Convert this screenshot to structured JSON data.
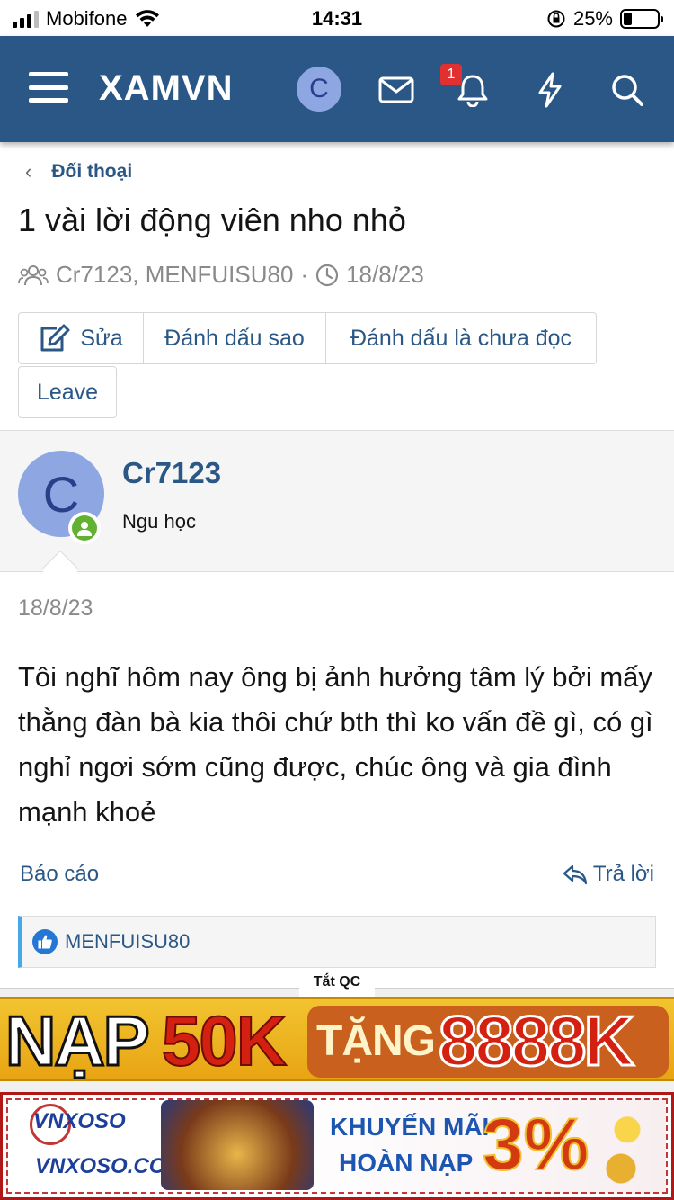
{
  "status_bar": {
    "carrier": "Mobifone",
    "time": "14:31",
    "battery": "25%"
  },
  "nav": {
    "logo": "XAMVN",
    "avatar_letter": "C",
    "notification_count": "1"
  },
  "breadcrumb": {
    "label": "Đối thoại"
  },
  "thread": {
    "title": "1 vài lời động viên nho nhỏ",
    "participants": "Cr7123, MENFUISU80",
    "separator": "·",
    "date": "18/8/23"
  },
  "actions": {
    "edit": "Sửa",
    "star": "Đánh dấu sao",
    "mark_unread": "Đánh dấu là chưa đọc",
    "leave": "Leave"
  },
  "message": {
    "avatar_letter": "C",
    "username": "Cr7123",
    "user_title": "Ngu học",
    "date": "18/8/23",
    "body": "Tôi nghĩ hôm nay ông bị ảnh hưởng tâm lý bởi mấy thằng đàn bà kia thôi chứ bth thì ko vấn đề gì, có gì nghỉ ngơi sớm cũng được, chúc ông và gia đình mạnh khoẻ",
    "report": "Báo cáo",
    "reply": "Trả lời",
    "reactions_by": "MENFUISU80"
  },
  "ads": {
    "close_label": "Tắt QC",
    "banner1": {
      "word1": "NẠP",
      "amount1": "50K",
      "word2": "TẶNG",
      "amount2": "8888K"
    },
    "banner2": {
      "brand": "VNXOSO",
      "url": "VNXOSO.COM",
      "line1": "KHUYẾN MÃI",
      "line2": "HOÀN NẠP",
      "percent": "3%"
    }
  },
  "colors": {
    "nav_bg": "#2a5785",
    "link": "#2a5785",
    "online": "#63b132",
    "badge": "#e03030",
    "reaction_accent": "#47a7eb"
  }
}
